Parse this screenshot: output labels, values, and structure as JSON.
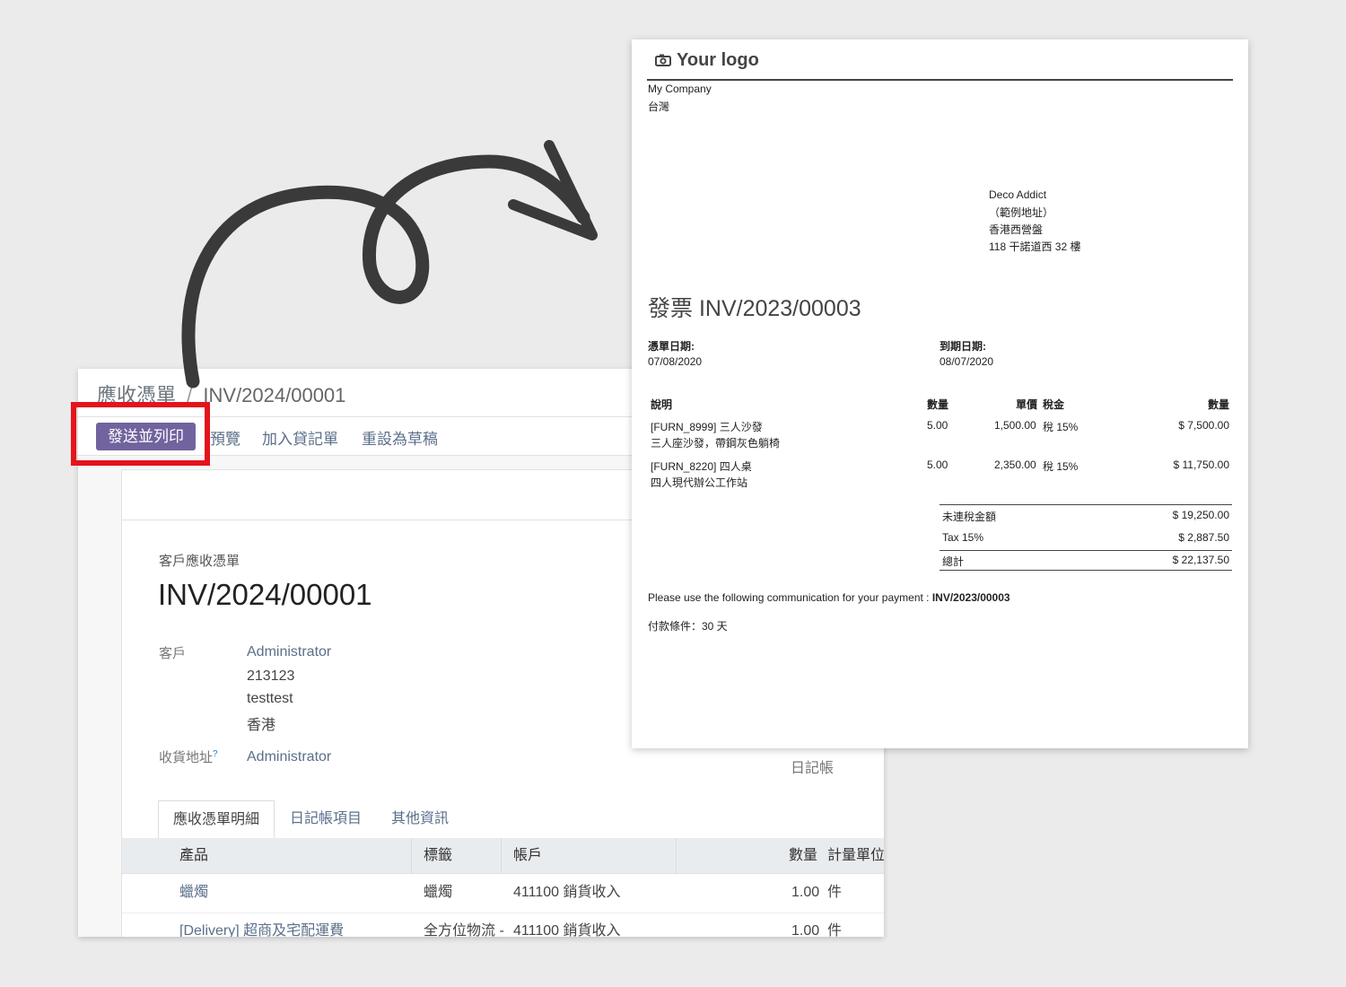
{
  "form": {
    "breadcrumb_parent": "應收憑單",
    "breadcrumb_sep": "/",
    "breadcrumb_current": "INV/2024/00001",
    "actions": {
      "send_print": "發送並列印",
      "preview": "預覽",
      "add_credit": "加入貸記單",
      "reset_draft": "重設為草稿"
    },
    "doc_kind": "客戶應收憑單",
    "doc_number": "INV/2024/00001",
    "customer_label": "客戶",
    "customer_name": "Administrator",
    "customer_addr1": "213123",
    "customer_addr2": "testtest",
    "customer_addr3": "香港",
    "delivery_label": "收貨地址",
    "delivery_help": "?",
    "delivery_value": "Administrator",
    "journal_label": "日記帳",
    "tabs": [
      "應收憑單明細",
      "日記帳項目",
      "其他資訊"
    ],
    "columns": {
      "product": "產品",
      "label": "標籤",
      "account": "帳戶",
      "qty": "數量",
      "uom": "計量單位"
    },
    "rows": [
      {
        "product": "蠟燭",
        "label": "蠟燭",
        "account": "411100 銷貨收入",
        "qty": "1.00",
        "uom": "件"
      },
      {
        "product": "[Delivery] 超商及宅配運費",
        "label": "全方位物流 -",
        "account": "411100 銷貨收入",
        "qty": "1.00",
        "uom": "件"
      }
    ]
  },
  "invoice": {
    "logo_text": "Your logo",
    "company_name": "My Company",
    "company_country": "台灣",
    "partner": [
      "Deco Addict",
      "（範例地址）",
      "香港西營盤",
      "118 干諾道西 32 樓"
    ],
    "title": "發票 INV/2023/00003",
    "invoice_date_label": "憑單日期:",
    "invoice_date": "07/08/2020",
    "due_date_label": "到期日期:",
    "due_date": "08/07/2020",
    "columns": {
      "desc": "說明",
      "qty": "數量",
      "price": "單價",
      "tax": "稅金",
      "amount": "數量"
    },
    "lines": [
      {
        "desc1": "[FURN_8999] 三人沙發",
        "desc2": "三人座沙發，帶鋼灰色躺椅",
        "qty": "5.00",
        "price": "1,500.00",
        "tax": "稅 15%",
        "amount": "$ 7,500.00"
      },
      {
        "desc1": "[FURN_8220] 四人桌",
        "desc2": "四人現代辦公工作站",
        "qty": "5.00",
        "price": "2,350.00",
        "tax": "稅 15%",
        "amount": "$ 11,750.00"
      }
    ],
    "untaxed_label": "未連稅金額",
    "untaxed": "$ 19,250.00",
    "tax_label": "Tax 15%",
    "tax": "$ 2,887.50",
    "total_label": "總計",
    "total": "$ 22,137.50",
    "payment_comm_prefix": "Please use the following communication for your payment : ",
    "payment_comm_ref": "INV/2023/00003",
    "payment_terms": "付款條件：30 天"
  },
  "colors": {
    "primary": "#71639e",
    "highlight": "#e4141c",
    "arrow": "#3a3a3a"
  }
}
